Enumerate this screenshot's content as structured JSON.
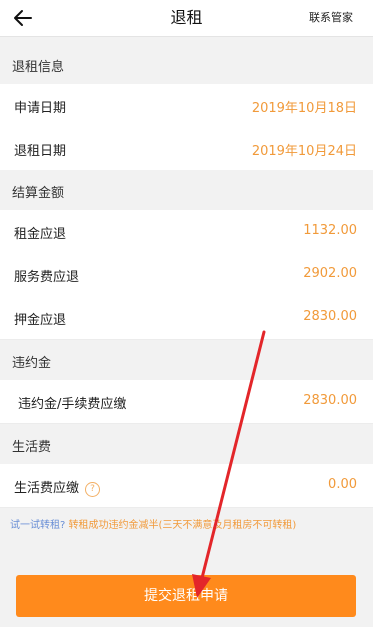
{
  "header": {
    "title": "退租",
    "contact_label": "联系管家"
  },
  "sections": {
    "info": {
      "title": "退租信息",
      "rows": [
        {
          "label": "申请日期",
          "value": "2019年10月18日"
        },
        {
          "label": "退租日期",
          "value": "2019年10月24日"
        }
      ]
    },
    "settlement": {
      "title": "结算金额",
      "rows": [
        {
          "label": "租金应退",
          "value": "1132.00"
        },
        {
          "label": "服务费应退",
          "value": "2902.00"
        },
        {
          "label": "押金应退",
          "value": "2830.00"
        }
      ]
    },
    "penalty": {
      "title": "违约金",
      "rows": [
        {
          "label": "违约金/手续费应缴",
          "value": "2830.00"
        }
      ]
    },
    "living": {
      "title": "生活费",
      "rows": [
        {
          "label": "生活费应缴",
          "value": "0.00"
        }
      ]
    }
  },
  "note": {
    "link": "试一试转租?",
    "text": "转租成功违约金减半(三天不满意及月租房不可转租)"
  },
  "submit_label": "提交退租申请",
  "colors": {
    "accent": "#ff8a1c",
    "value": "#f19a3a",
    "link": "#6a8fd6",
    "arrow": "#e3262a"
  }
}
